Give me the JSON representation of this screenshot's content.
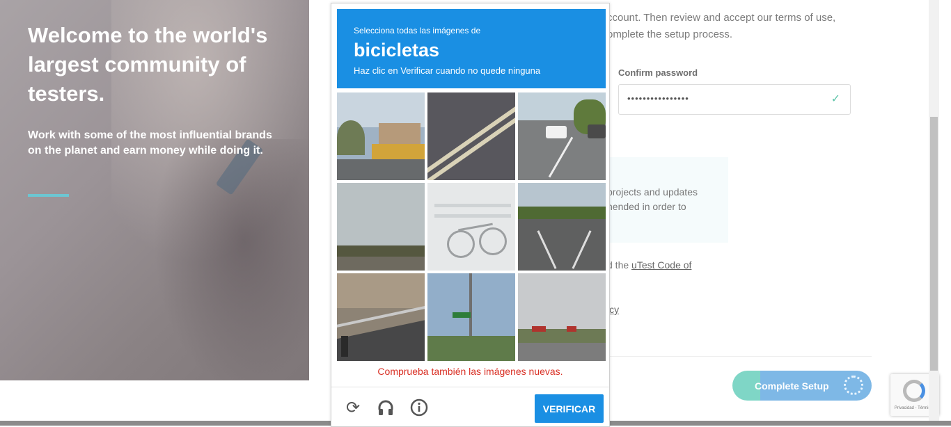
{
  "hero": {
    "title": "Welcome to the world's largest community of testers.",
    "subtitle": "Work with some of the most influential brands on the planet and earn money while doing it."
  },
  "form": {
    "intro": "ccount. Then review and accept our terms of use, omplete the setup process.",
    "confirm_label": "Confirm password",
    "confirm_value": "••••••••••••••••",
    "info_text": "projects and updates nended in order to",
    "code_prefix": "d the ",
    "code_link": "uTest Code of",
    "policy_link": "icy",
    "complete_label": "Complete Setup"
  },
  "recaptcha_badge": {
    "links": "Privacidad - Términos"
  },
  "captcha": {
    "instruction": "Selecciona todas las imágenes de",
    "target": "bicicletas",
    "hint": "Haz clic en Verificar cuando no quede ninguna",
    "error": "Comprueba también las imágenes nuevas.",
    "verify_label": "VERIFICAR",
    "icons": [
      "reload-icon",
      "headphones-icon",
      "info-icon"
    ]
  },
  "colors": {
    "captcha_blue": "#1a8fe3",
    "error_red": "#d93025",
    "accent_teal": "#6cc6d2"
  }
}
